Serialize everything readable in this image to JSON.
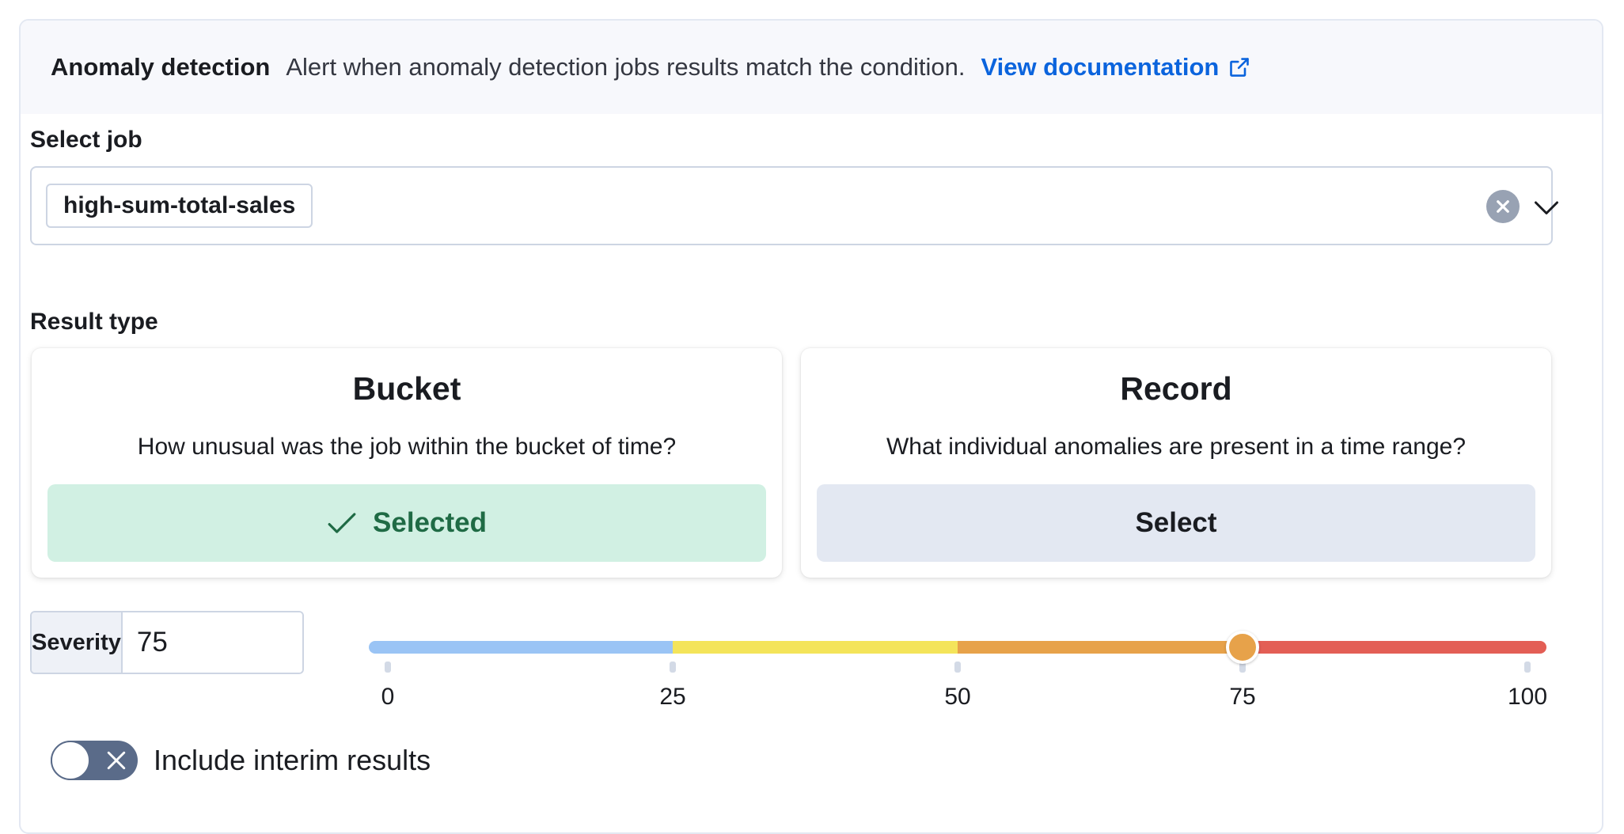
{
  "header": {
    "title": "Anomaly detection",
    "description": "Alert when anomaly detection jobs results match the condition.",
    "doc_link": "View documentation",
    "icon": "external-link-icon"
  },
  "job": {
    "label": "Select job",
    "selected": "high-sum-total-sales"
  },
  "result_type": {
    "label": "Result type",
    "options": [
      {
        "title": "Bucket",
        "description": "How unusual was the job within the bucket of time?",
        "button": "Selected",
        "selected": true
      },
      {
        "title": "Record",
        "description": "What individual anomalies are present in a time range?",
        "button": "Select",
        "selected": false
      }
    ]
  },
  "severity": {
    "label": "Severity",
    "value": "75",
    "min": 0,
    "max": 100,
    "ticks": [
      "0",
      "25",
      "50",
      "75",
      "100"
    ],
    "thumb_color": "#e7a24a",
    "segment_colors": [
      "#9ac4f5",
      "#f4e45a",
      "#e7a24a",
      "#e35e55"
    ]
  },
  "interim": {
    "label": "Include interim results",
    "enabled": false
  },
  "colors": {
    "link": "#0b64dd",
    "selected_bg": "#d1f0e3",
    "selected_text": "#1f6b45"
  }
}
